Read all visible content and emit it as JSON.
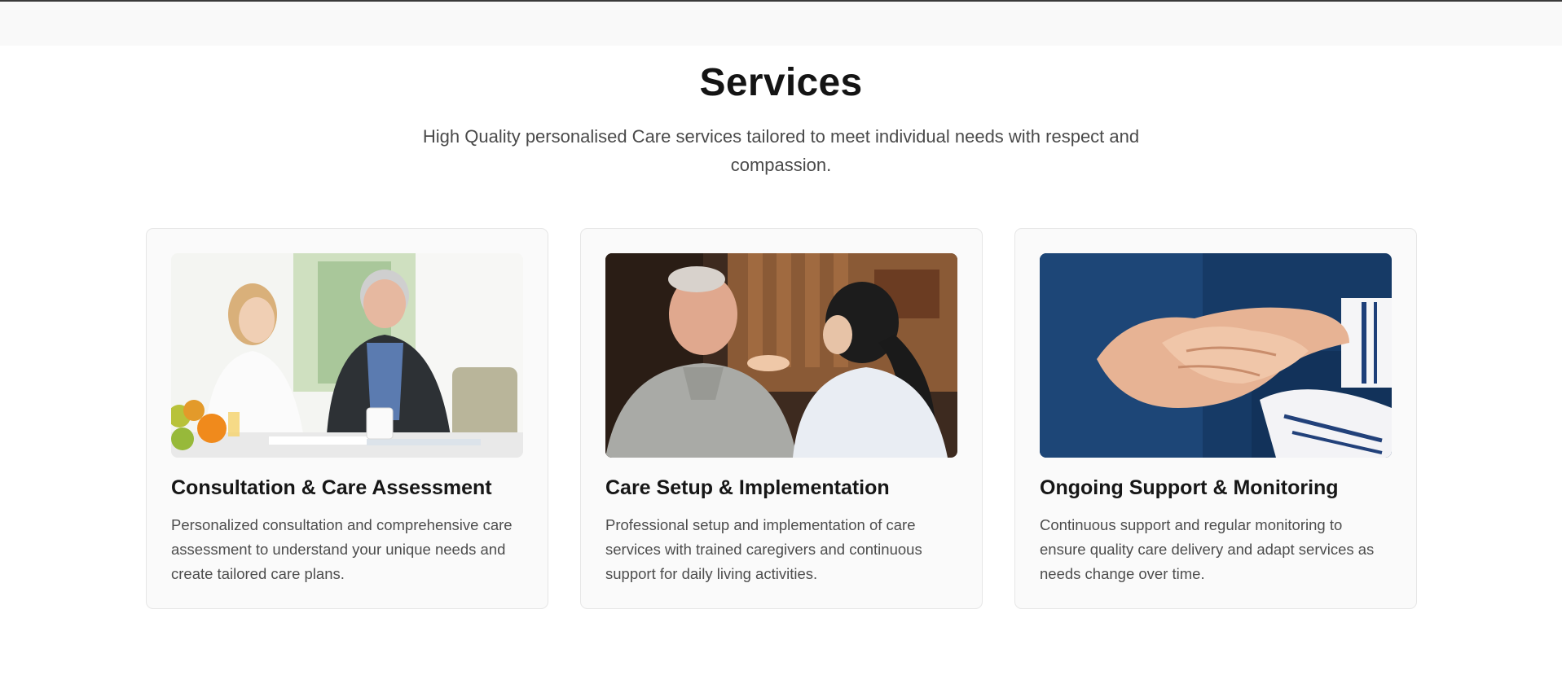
{
  "section": {
    "title": "Services",
    "subtitle": "High Quality personalised Care services tailored to meet individual needs with respect and compassion."
  },
  "cards": [
    {
      "title": "Consultation & Care Assessment",
      "description": "Personalized consultation and comprehensive care assessment to understand your unique needs and create tailored care plans."
    },
    {
      "title": "Care Setup & Implementation",
      "description": "Professional setup and implementation of care services with trained caregivers and continuous support for daily living activities."
    },
    {
      "title": "Ongoing Support & Monitoring",
      "description": "Continuous support and regular monitoring to ensure quality care delivery and adapt services as needs change over time."
    }
  ],
  "colors": {
    "heading": "#141414",
    "body_text": "#4d4d4d",
    "card_background": "#fafafa",
    "card_border": "#e6e6e6",
    "top_rule": "#3a3a3a"
  }
}
